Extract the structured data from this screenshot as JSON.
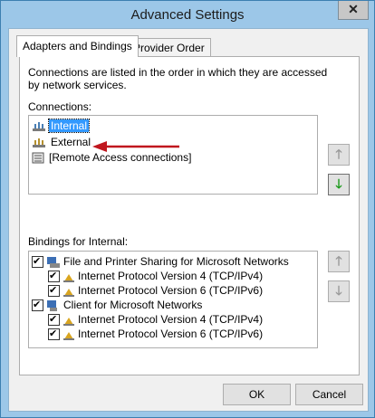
{
  "window": {
    "title": "Advanced Settings",
    "close_glyph": "✕"
  },
  "tabs": [
    {
      "label": "Adapters and Bindings"
    },
    {
      "label": "Provider Order"
    }
  ],
  "panel": {
    "description": "Connections are listed in the order in which they are accessed by network services.",
    "connections_label": "Connections:",
    "connections": [
      {
        "label": "Internal",
        "icon": "network-adapter-icon"
      },
      {
        "label": "External",
        "icon": "network-adapter-icon"
      },
      {
        "label": "[Remote Access connections]",
        "icon": "remote-access-icon"
      }
    ],
    "bindings_label": "Bindings for Internal:",
    "bindings": [
      {
        "label": "File and Printer Sharing for Microsoft Networks",
        "icon": "service-icon",
        "level": 0,
        "checked": true
      },
      {
        "label": "Internet Protocol Version 4 (TCP/IPv4)",
        "icon": "protocol-icon",
        "level": 1,
        "checked": true
      },
      {
        "label": "Internet Protocol Version 6 (TCP/IPv6)",
        "icon": "protocol-icon",
        "level": 1,
        "checked": true
      },
      {
        "label": "Client for Microsoft Networks",
        "icon": "client-icon",
        "level": 0,
        "checked": true
      },
      {
        "label": "Internet Protocol Version 4 (TCP/IPv4)",
        "icon": "protocol-icon",
        "level": 1,
        "checked": true
      },
      {
        "label": "Internet Protocol Version 6 (TCP/IPv6)",
        "icon": "protocol-icon",
        "level": 1,
        "checked": true
      }
    ]
  },
  "buttons": {
    "ok": "OK",
    "cancel": "Cancel"
  },
  "colors": {
    "selection": "#3399ff",
    "annotation_arrow": "#c0161e",
    "move_down_enabled": "#1a9a1a"
  }
}
